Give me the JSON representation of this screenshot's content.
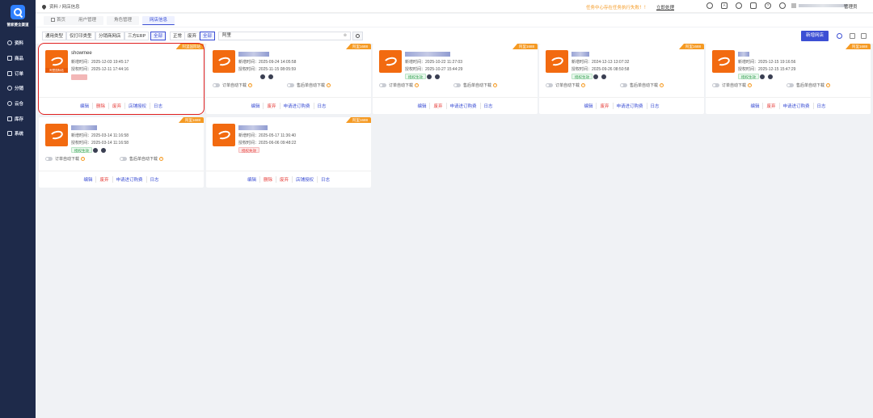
{
  "sidebar": {
    "brand": "管家婆全渠道",
    "items": [
      {
        "label": "资料",
        "icon": "gear-icon"
      },
      {
        "label": "商品",
        "icon": "box-icon"
      },
      {
        "label": "订单",
        "icon": "order-icon"
      },
      {
        "label": "分销",
        "icon": "share-icon"
      },
      {
        "label": "云仓",
        "icon": "cloud-icon"
      },
      {
        "label": "库存",
        "icon": "warehouse-icon"
      },
      {
        "label": "系统",
        "icon": "monitor-icon"
      }
    ]
  },
  "topbar": {
    "breadcrumb": "资料 / 网店信息",
    "task_notice": "任务中心存在任务执行失败！！",
    "task_link": "立即处理",
    "icons": [
      "search-icon",
      "font-size-icon",
      "message-icon",
      "notice-icon",
      "help-icon",
      "bell-icon"
    ],
    "user_role": "管理员"
  },
  "tabs": [
    {
      "label": "首页",
      "active": false
    },
    {
      "label": "用户管理",
      "active": false
    },
    {
      "label": "角色管理",
      "active": false
    },
    {
      "label": "网店信息",
      "active": true
    }
  ],
  "filters": {
    "type_buttons": [
      "通用类型",
      "仅打印类型",
      "分销商网店",
      "三方ERP",
      "全部"
    ],
    "status_buttons": [
      "正常",
      "废弃",
      "全部"
    ],
    "search_value": "阿里",
    "new_shop_label": "新增网店"
  },
  "labels": {
    "added": "新增时间：",
    "authorized": "授权时间：",
    "order_auto": "订单自动下载",
    "aftersale_auto": "售后单自动下载"
  },
  "cards": [
    {
      "ribbon": "阿里国际站",
      "name": "showmee",
      "thumb_label": "阿里国际站",
      "added": "2025-12-03 19:45:17",
      "auth": "2025-12-11 17:44:16",
      "badge": "",
      "badge_type": "blurred",
      "toggles": false,
      "actions": [
        {
          "t": "编辑",
          "c": "blue"
        },
        {
          "t": "删除",
          "c": "red"
        },
        {
          "t": "废弃",
          "c": "red"
        },
        {
          "t": "店铺授权",
          "c": "blue"
        },
        {
          "t": "日志",
          "c": "blue"
        }
      ]
    },
    {
      "ribbon": "阿里1688",
      "name": "",
      "added": "2025-09-24 14:05:58",
      "auth": "2025-11-15 08:05:59",
      "badge": "",
      "badge_type": "none",
      "toggles": true,
      "actions": [
        {
          "t": "编辑",
          "c": "blue"
        },
        {
          "t": "废弃",
          "c": "red"
        },
        {
          "t": "申请进订购费",
          "c": "blue"
        },
        {
          "t": "日志",
          "c": "blue"
        }
      ]
    },
    {
      "ribbon": "阿里1688",
      "name": "",
      "added": "2025-10-22 11:27:03",
      "auth": "2025-10-27 15:44:29",
      "badge": "授权生效",
      "badge_type": "green",
      "toggles": true,
      "actions": [
        {
          "t": "编辑",
          "c": "blue"
        },
        {
          "t": "废弃",
          "c": "red"
        },
        {
          "t": "申请进订购费",
          "c": "blue"
        },
        {
          "t": "日志",
          "c": "blue"
        }
      ]
    },
    {
      "ribbon": "阿里1688",
      "name": "",
      "added": "2024-12-13 13:07:32",
      "auth": "2025-09-26 08:50:58",
      "badge": "授权生效",
      "badge_type": "green",
      "toggles": true,
      "actions": [
        {
          "t": "编辑",
          "c": "blue"
        },
        {
          "t": "废弃",
          "c": "red"
        },
        {
          "t": "申请进订购费",
          "c": "blue"
        },
        {
          "t": "日志",
          "c": "blue"
        }
      ]
    },
    {
      "ribbon": "阿里1688",
      "name": "",
      "added": "2025-12-15 19:16:56",
      "auth": "2025-12-15 15:47:29",
      "badge": "授权生效",
      "badge_type": "green",
      "toggles": true,
      "actions": [
        {
          "t": "编辑",
          "c": "blue"
        },
        {
          "t": "废弃",
          "c": "red"
        },
        {
          "t": "申请进订购费",
          "c": "blue"
        },
        {
          "t": "日志",
          "c": "blue"
        }
      ]
    },
    {
      "ribbon": "阿里1688",
      "name": "",
      "added": "2025-03-14 11:16:58",
      "auth": "2025-03-14 11:16:58",
      "badge": "授权生效",
      "badge_type": "green",
      "toggles": true,
      "actions": [
        {
          "t": "编辑",
          "c": "blue"
        },
        {
          "t": "废弃",
          "c": "red"
        },
        {
          "t": "申请进订购费",
          "c": "blue"
        },
        {
          "t": "日志",
          "c": "blue"
        }
      ]
    },
    {
      "ribbon": "阿里1688",
      "name": "",
      "added": "2025-05-17 11:36:40",
      "auth": "2025-06-06 09:48:22",
      "badge": "授权失效",
      "badge_type": "red",
      "toggles": false,
      "actions": [
        {
          "t": "编辑",
          "c": "blue"
        },
        {
          "t": "删除",
          "c": "red"
        },
        {
          "t": "废弃",
          "c": "red"
        },
        {
          "t": "店铺授权",
          "c": "blue"
        },
        {
          "t": "日志",
          "c": "blue"
        }
      ]
    }
  ]
}
